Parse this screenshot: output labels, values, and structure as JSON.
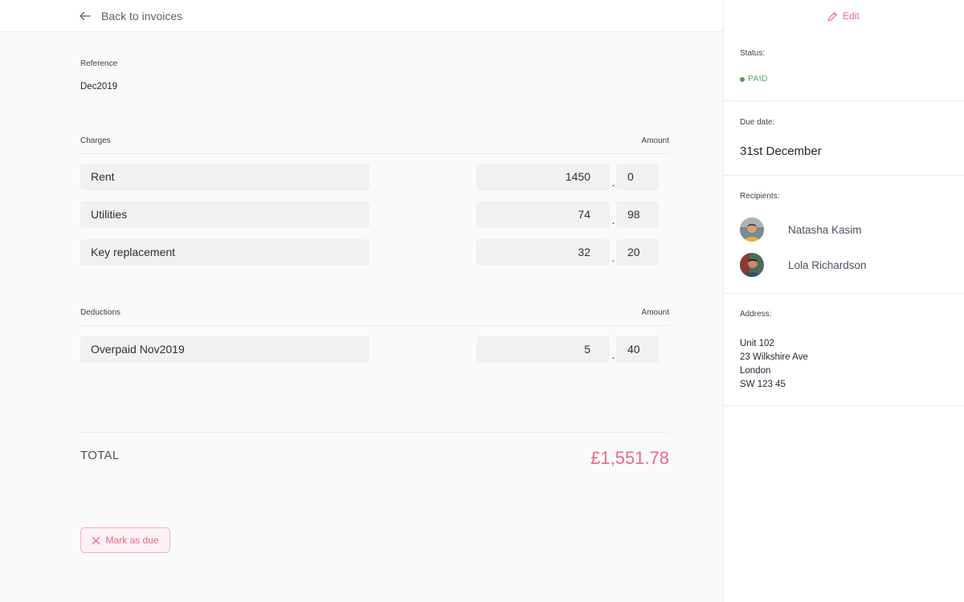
{
  "header": {
    "back_label": "Back to invoices",
    "edit_label": "Edit"
  },
  "reference": {
    "label": "Reference",
    "value": "Dec2019"
  },
  "charges": {
    "label": "Charges",
    "amount_label": "Amount",
    "items": [
      {
        "name": "Rent",
        "whole": "1450",
        "fraction": "0"
      },
      {
        "name": "Utilities",
        "whole": "74",
        "fraction": "98"
      },
      {
        "name": "Key replacement",
        "whole": "32",
        "fraction": "20"
      }
    ]
  },
  "deductions": {
    "label": "Deductions",
    "amount_label": "Amount",
    "items": [
      {
        "name": "Overpaid Nov2019",
        "whole": "5",
        "fraction": "40"
      }
    ]
  },
  "decimal_separator": ".",
  "total": {
    "label": "TOTAL",
    "value": "£1,551.78"
  },
  "actions": {
    "mark_due_label": "Mark as due"
  },
  "sidebar": {
    "status": {
      "label": "Status:",
      "value": "PAID"
    },
    "due_date": {
      "label": "Due date:",
      "value": "31st December"
    },
    "recipients": {
      "label": "Recipients:",
      "items": [
        {
          "name": "Natasha Kasim"
        },
        {
          "name": "Lola Richardson"
        }
      ]
    },
    "address": {
      "label": "Address:",
      "lines": [
        "Unit 102",
        "23 Wilkshire Ave",
        "London",
        "SW 123 45"
      ]
    }
  },
  "colors": {
    "accent": "#f0668a",
    "paid": "#4aa65b"
  }
}
